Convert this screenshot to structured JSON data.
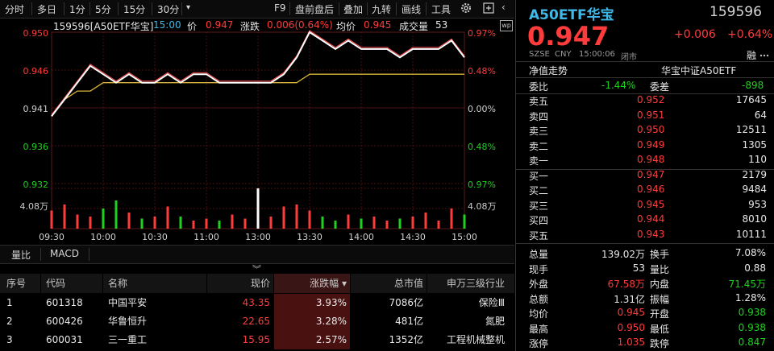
{
  "toolbar": {
    "items": [
      "分时",
      "多日",
      "1分",
      "5分",
      "15分",
      "30分"
    ],
    "caret": "▾",
    "right_items": [
      "F9",
      "盘前盘后",
      "叠加",
      "九转",
      "画线",
      "工具"
    ],
    "more": "‹"
  },
  "chart_header": {
    "symbol": "159596[A50ETF华宝]",
    "time": "15:00",
    "price_label": "价",
    "price": "0.947",
    "change_label": "涨跌",
    "change": "0.006(0.64%)",
    "avg_label": "均价",
    "avg": "0.945",
    "vol_label": "成交量",
    "vol": "53"
  },
  "chart_data": {
    "type": "line",
    "price_axis": [
      "0.950",
      "0.946",
      "0.941",
      "0.936",
      "0.932"
    ],
    "pct_axis": [
      "0.97%",
      "0.48%",
      "0.00%",
      "0.48%",
      "0.97%"
    ],
    "vol_axis": [
      "4.08万",
      "4.08万"
    ],
    "x_labels": [
      "09:30",
      "10:00",
      "10:30",
      "11:00",
      "13:00",
      "13:30",
      "14:00",
      "14:30",
      "15:00"
    ],
    "ylim": [
      0.932,
      0.95
    ],
    "price": [
      0.94,
      0.942,
      0.944,
      0.946,
      0.945,
      0.944,
      0.945,
      0.944,
      0.944,
      0.945,
      0.944,
      0.945,
      0.945,
      0.944,
      0.944,
      0.944,
      0.944,
      0.944,
      0.945,
      0.947,
      0.95,
      0.949,
      0.948,
      0.949,
      0.948,
      0.948,
      0.948,
      0.947,
      0.948,
      0.948,
      0.948,
      0.949,
      0.947
    ],
    "avg": [
      0.94,
      0.942,
      0.943,
      0.943,
      0.944,
      0.944,
      0.944,
      0.944,
      0.944,
      0.944,
      0.944,
      0.944,
      0.944,
      0.944,
      0.944,
      0.944,
      0.944,
      0.944,
      0.944,
      0.944,
      0.945,
      0.945,
      0.945,
      0.945,
      0.945,
      0.945,
      0.945,
      0.945,
      0.945,
      0.945,
      0.945,
      0.945,
      0.945
    ],
    "volume": [
      0.45,
      0.6,
      0.35,
      0.3,
      0.5,
      0.7,
      0.4,
      0.25,
      0.3,
      0.55,
      0.3,
      0.2,
      0.25,
      0.2,
      0.35,
      0.25,
      1.0,
      0.3,
      0.55,
      0.6,
      0.45,
      0.3,
      0.2,
      0.35,
      0.25,
      0.3,
      0.2,
      0.25,
      0.3,
      0.4,
      0.2,
      0.5,
      0.35
    ],
    "colors": {
      "price": "#ffffff",
      "avg": "#d8b43c",
      "overlay": "#ff4d4d",
      "grid": "#4a0f0f",
      "axis_red": "#ff3b3b",
      "axis_green": "#1fd11f"
    }
  },
  "tabs": [
    "量比",
    "MACD"
  ],
  "collapse_icon": "︾",
  "table": {
    "headers": [
      "序号",
      "代码",
      "名称",
      "现价",
      "涨跌幅 ▾",
      "总市值",
      "申万三级行业"
    ],
    "rows": [
      {
        "no": "1",
        "code": "601318",
        "name": "中国平安",
        "price": "43.35",
        "pct": "3.93%",
        "cap": "7086亿",
        "ind": "保险Ⅲ"
      },
      {
        "no": "2",
        "code": "600426",
        "name": "华鲁恒升",
        "price": "22.65",
        "pct": "3.28%",
        "cap": "481亿",
        "ind": "氮肥"
      },
      {
        "no": "3",
        "code": "600031",
        "name": "三一重工",
        "price": "15.95",
        "pct": "2.57%",
        "cap": "1352亿",
        "ind": "工程机械整机"
      }
    ]
  },
  "quote": {
    "name": "A50ETF华宝",
    "code": "159596",
    "price": "0.947",
    "change": "+0.006",
    "pct": "+0.64%",
    "exchange": "SZSE",
    "currency": "CNY",
    "time": "15:00:06",
    "status": "闭市",
    "rong": "融",
    "nav_label": "净值走势",
    "index_name": "华宝中证A50ETF",
    "webi_label": "委比",
    "webi": "-1.44%",
    "weicha_label": "委差",
    "weicha": "-898"
  },
  "asks": [
    {
      "label": "卖五",
      "price": "0.952",
      "vol": "17645"
    },
    {
      "label": "卖四",
      "price": "0.951",
      "vol": "64"
    },
    {
      "label": "卖三",
      "price": "0.950",
      "vol": "12511"
    },
    {
      "label": "卖二",
      "price": "0.949",
      "vol": "1305"
    },
    {
      "label": "卖一",
      "price": "0.948",
      "vol": "110"
    }
  ],
  "bids": [
    {
      "label": "买一",
      "price": "0.947",
      "vol": "2179"
    },
    {
      "label": "买二",
      "price": "0.946",
      "vol": "9484"
    },
    {
      "label": "买三",
      "price": "0.945",
      "vol": "953"
    },
    {
      "label": "买四",
      "price": "0.944",
      "vol": "8010"
    },
    {
      "label": "买五",
      "price": "0.943",
      "vol": "10111"
    }
  ],
  "stats": [
    {
      "l1": "总量",
      "v1": "139.02万",
      "c1": "white",
      "l2": "换手",
      "v2": "7.08%",
      "c2": "white"
    },
    {
      "l1": "现手",
      "v1": "53",
      "c1": "white",
      "l2": "量比",
      "v2": "0.88",
      "c2": "white"
    },
    {
      "l1": "外盘",
      "v1": "67.58万",
      "c1": "red",
      "l2": "内盘",
      "v2": "71.45万",
      "c2": "green"
    },
    {
      "l1": "总额",
      "v1": "1.31亿",
      "c1": "white",
      "l2": "振幅",
      "v2": "1.28%",
      "c2": "white"
    },
    {
      "l1": "均价",
      "v1": "0.945",
      "c1": "red",
      "l2": "开盘",
      "v2": "0.938",
      "c2": "green"
    },
    {
      "l1": "最高",
      "v1": "0.950",
      "c1": "red",
      "l2": "最低",
      "v2": "0.938",
      "c2": "green"
    },
    {
      "l1": "涨停",
      "v1": "1.035",
      "c1": "red",
      "l2": "跌停",
      "v2": "0.847",
      "c2": "green"
    }
  ]
}
